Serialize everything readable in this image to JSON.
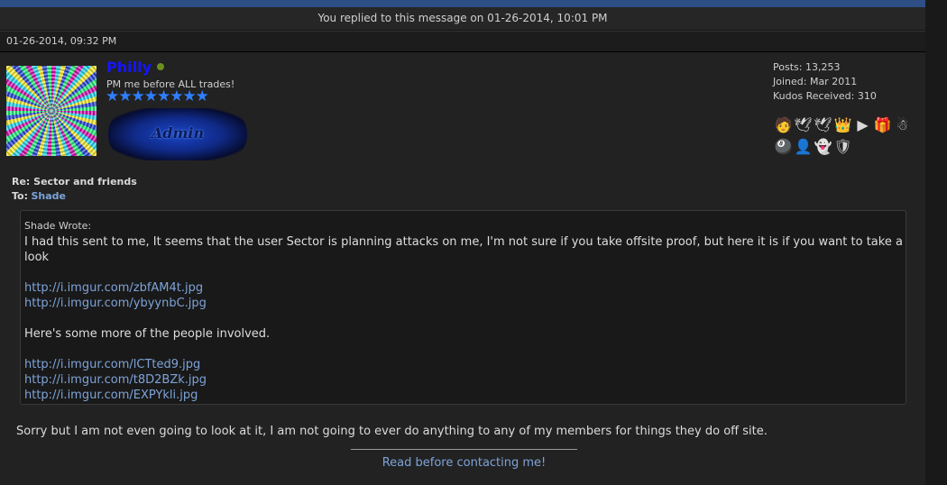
{
  "notice": "You replied to this message on 01-26-2014, 10:01 PM",
  "post": {
    "date": "01-26-2014, 09:32 PM",
    "author": {
      "username": "Philly",
      "title": "PM me before ALL trades!",
      "stars": "★★★★★★★★",
      "badge_text": "Admin",
      "online_color": "#6a8f1e"
    },
    "stats": {
      "posts": "Posts: 13,253",
      "joined": "Joined: Mar 2011",
      "kudos": "Kudos Received: 310"
    },
    "awards": [
      {
        "icon": "chef-icon",
        "glyph": "🧑"
      },
      {
        "icon": "wings-icon",
        "glyph": "🕊"
      },
      {
        "icon": "wings-icon",
        "glyph": "🕊"
      },
      {
        "icon": "crown-icon",
        "glyph": "👑"
      },
      {
        "icon": "youtube-icon",
        "glyph": "▶"
      },
      {
        "icon": "gift-icon",
        "glyph": "🎁"
      },
      {
        "icon": "snowman-icon",
        "glyph": "☃"
      },
      {
        "icon": "billiards-icon",
        "glyph": "🎱"
      },
      {
        "icon": "user-icon",
        "glyph": "👤"
      },
      {
        "icon": "ghost-icon",
        "glyph": "👻"
      },
      {
        "icon": "shield-icon",
        "glyph": "🛡"
      }
    ],
    "subject_label": "Re: Sector and friends",
    "to_label": "To:",
    "to_user": "Shade",
    "quote": {
      "header": "Shade Wrote:",
      "text1": "I had this sent to me, It seems that the user Sector is planning attacks on me, I'm not sure if you take offsite proof, but here it is if you want to take a look",
      "links1": [
        "http://i.imgur.com/zbfAM4t.jpg",
        "http://i.imgur.com/ybyynbC.jpg"
      ],
      "text2": "Here's some more of the people involved.",
      "links2": [
        "http://i.imgur.com/lCTted9.jpg",
        "http://i.imgur.com/t8D2BZk.jpg",
        "http://i.imgur.com/EXPYkli.jpg"
      ]
    },
    "reply": "Sorry but I am not even going to look at it, I am not going to ever do anything to any of my members for things they do off site.",
    "signature_link": "Read before contacting me!"
  },
  "colors": {
    "link": "#7da3d8",
    "username": "#1515ff",
    "stars": "#2f7fff",
    "background": "#222222"
  }
}
